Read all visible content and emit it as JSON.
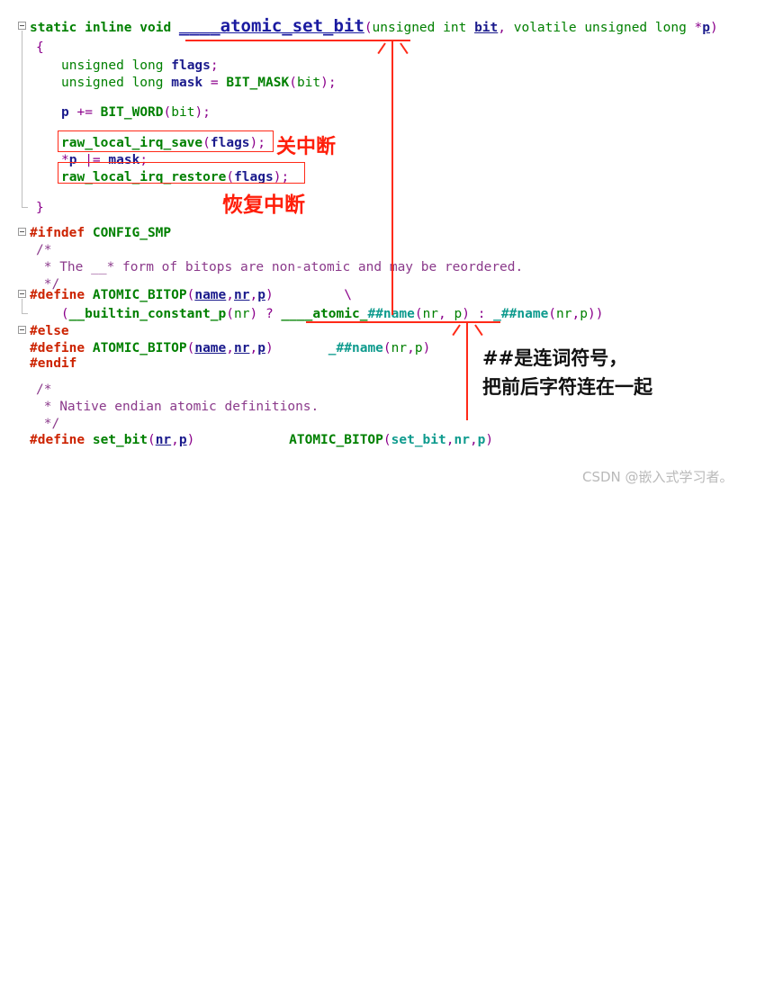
{
  "document": {
    "kind": "source-code-screenshot",
    "language": "C"
  },
  "code_lines": [
    {
      "id": "fn-signature",
      "text": "static inline void ____atomic_set_bit(unsigned int bit, volatile unsigned long *p)"
    },
    {
      "id": "open-brace",
      "text": "{"
    },
    {
      "id": "decl-flags",
      "text": "unsigned long flags;"
    },
    {
      "id": "decl-mask",
      "text": "unsigned long mask = BIT_MASK(bit);"
    },
    {
      "id": "stmt-p-plus",
      "text": "p += BIT_WORD(bit);"
    },
    {
      "id": "stmt-irq-save",
      "text": "raw_local_irq_save(flags);"
    },
    {
      "id": "stmt-or-mask",
      "text": "*p |= mask;"
    },
    {
      "id": "stmt-irq-restore",
      "text": "raw_local_irq_restore(flags);"
    },
    {
      "id": "close-brace",
      "text": "}"
    },
    {
      "id": "ifndef-smp",
      "text": "#ifndef CONFIG_SMP"
    },
    {
      "id": "comment-open-1",
      "text": "/*"
    },
    {
      "id": "comment-body-1",
      "text": " * The __* form of bitops are non-atomic and may be reordered."
    },
    {
      "id": "comment-close-1",
      "text": " */"
    },
    {
      "id": "define-bitop-smp",
      "text": "#define ATOMIC_BITOP(name,nr,p)          \\"
    },
    {
      "id": "define-bitop-smp-body",
      "text": "    (__builtin_constant_p(nr) ? ____atomic_##name(nr, p) : _##name(nr,p))"
    },
    {
      "id": "else",
      "text": "#else"
    },
    {
      "id": "define-bitop-else",
      "text": "#define ATOMIC_BITOP(name,nr,p)        _##name(nr,p)"
    },
    {
      "id": "endif",
      "text": "#endif"
    },
    {
      "id": "comment-open-2",
      "text": "/*"
    },
    {
      "id": "comment-body-2",
      "text": " * Native endian atomic definitions."
    },
    {
      "id": "comment-close-2",
      "text": " */"
    },
    {
      "id": "define-set-bit",
      "text": "#define set_bit(nr,p)            ATOMIC_BITOP(set_bit,nr,p)"
    }
  ],
  "tokens": {
    "kw_static": "static",
    "kw_inline": "inline",
    "kw_void": "void",
    "fn_atomic_set_bit": "____atomic_set_bit",
    "kw_unsigned": "unsigned",
    "kw_int": "int",
    "kw_long": "long",
    "kw_volatile": "volatile",
    "var_bit": "bit",
    "var_p": "p",
    "var_flags": "flags",
    "var_mask": "mask",
    "var_nr": "nr",
    "var_name": "name",
    "macro_bit_mask": "BIT_MASK",
    "macro_bit_word": "BIT_WORD",
    "macro_atomic_bitop": "ATOMIC_BITOP",
    "macro_set_bit": "set_bit",
    "fn_irq_save": "raw_local_irq_save",
    "fn_irq_restore": "raw_local_irq_restore",
    "fn_builtin_constant_p": "__builtin_constant_p",
    "pre_ifndef": "#ifndef",
    "pre_define": "#define",
    "pre_else": "#else",
    "pre_endif": "#endif",
    "sym_config_smp": "CONFIG_SMP"
  },
  "annotations": {
    "irq_off": "关中断",
    "irq_restore": "恢复中断",
    "concat_line1": "##是连词符号，",
    "concat_line2": "把前后字符连在一起"
  },
  "watermark": {
    "text": "CSDN @嵌入式学习者。"
  },
  "colors": {
    "annotation_red": "#ff2a18",
    "keyword_green": "#008000",
    "identifier_blue": "#1a1a8c",
    "comment_purple": "#8b3a8b",
    "preprocessor_red": "#cc2200",
    "macro_teal": "#0f9b8e",
    "punctuation_magenta": "#8b008b",
    "watermark_gray": "#b9b9b9",
    "background": "#ffffff"
  }
}
